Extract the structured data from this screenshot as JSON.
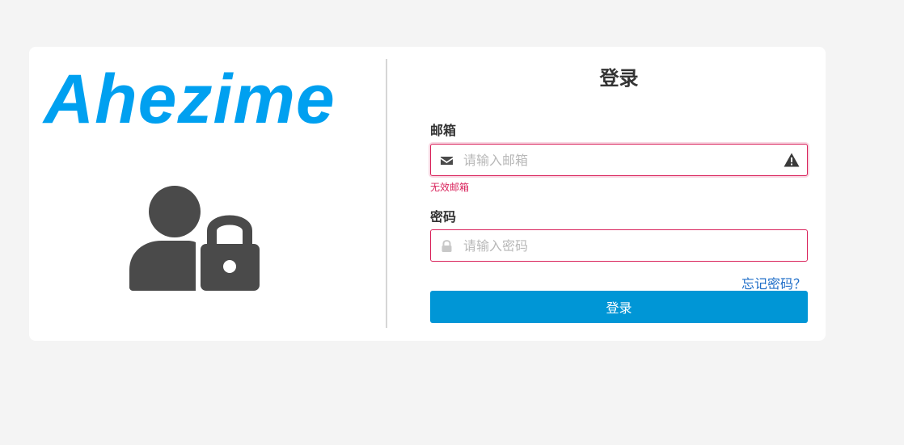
{
  "brand": {
    "name": "Ahezime",
    "color": "#00a0f0"
  },
  "hero": {
    "icon": "user-lock-icon"
  },
  "login_form": {
    "title": "登录",
    "email": {
      "label": "邮箱",
      "placeholder": "请输入邮箱",
      "value": "",
      "icon": "envelope-icon",
      "status_icon": "warning-icon",
      "error": "无效邮箱"
    },
    "password": {
      "label": "密码",
      "placeholder": "请输入密码",
      "value": "",
      "icon": "lock-icon"
    },
    "forgot_link": "忘记密码？",
    "submit_label": "登录"
  },
  "colors": {
    "page_background": "#f4f4f4",
    "card_background": "#ffffff",
    "accent": "#0096d6",
    "error": "#d9245c",
    "link": "#1f6ec8",
    "icon_dark": "#4a4a4a"
  }
}
